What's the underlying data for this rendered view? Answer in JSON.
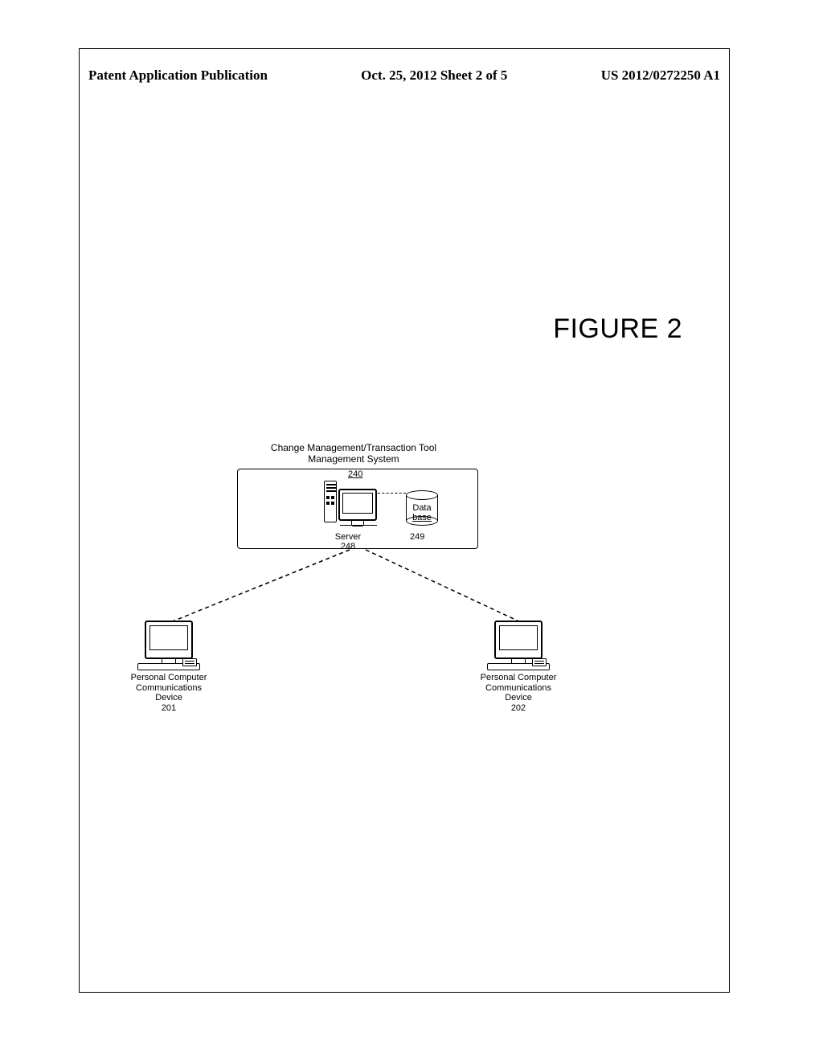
{
  "header": {
    "left": "Patent Application Publication",
    "center": "Oct. 25, 2012  Sheet 2 of 5",
    "right": "US 2012/0272250 A1"
  },
  "figure_title": "FIGURE 2",
  "system": {
    "title_line1": "Change Management/Transaction Tool",
    "title_line2": "Management System",
    "number": "240"
  },
  "server": {
    "label": "Server",
    "number": "248"
  },
  "database": {
    "label_line1": "Data",
    "label_line2": "base",
    "number": "249"
  },
  "pc1": {
    "label_line1": "Personal Computer",
    "label_line2": "Communications Device",
    "number": "201"
  },
  "pc2": {
    "label_line1": "Personal Computer",
    "label_line2": "Communications Device",
    "number": "202"
  }
}
